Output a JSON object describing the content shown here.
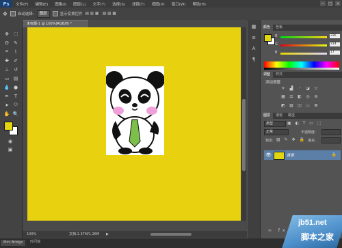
{
  "app": {
    "logo": "Ps"
  },
  "menu": [
    "文件(F)",
    "编辑(E)",
    "图像(I)",
    "图层(L)",
    "文字(Y)",
    "选择(S)",
    "滤镜(T)",
    "视图(V)",
    "窗口(W)",
    "帮助(H)"
  ],
  "window_controls": {
    "minimize": "−",
    "maximize": "□",
    "close": "×"
  },
  "options": {
    "auto_select_label": "自动选择:",
    "auto_select_value": "图层",
    "show_transform_label": "显示变换控件"
  },
  "document": {
    "tab_title": "未标题-1 @ 100%(RGB/8) *",
    "zoom": "100%",
    "doc_size": "文档:1.37M/1.26M"
  },
  "bottom": {
    "mini_bridge": "Mini Bridge",
    "timeline": "时间轴"
  },
  "color_panel": {
    "tabs": [
      "颜色",
      "色板"
    ],
    "channels": [
      {
        "name": "R",
        "value": "226"
      },
      {
        "name": "G",
        "value": "214"
      },
      {
        "name": "B",
        "value": "17"
      }
    ],
    "foreground": "#e2d611",
    "background": "#ffffff"
  },
  "adjustments_panel": {
    "tabs": [
      "调整",
      "样式"
    ],
    "title": "添加调整"
  },
  "layers_panel": {
    "tabs": [
      "图层",
      "通道",
      "路径"
    ],
    "kind_label": "类型",
    "blend_mode": "正常",
    "opacity_label": "不透明度:",
    "lock_label": "锁定:",
    "fill_label": "填充:",
    "layer_name": "背景"
  },
  "watermark": {
    "site": "jb51.net",
    "name": "脚本之家"
  }
}
